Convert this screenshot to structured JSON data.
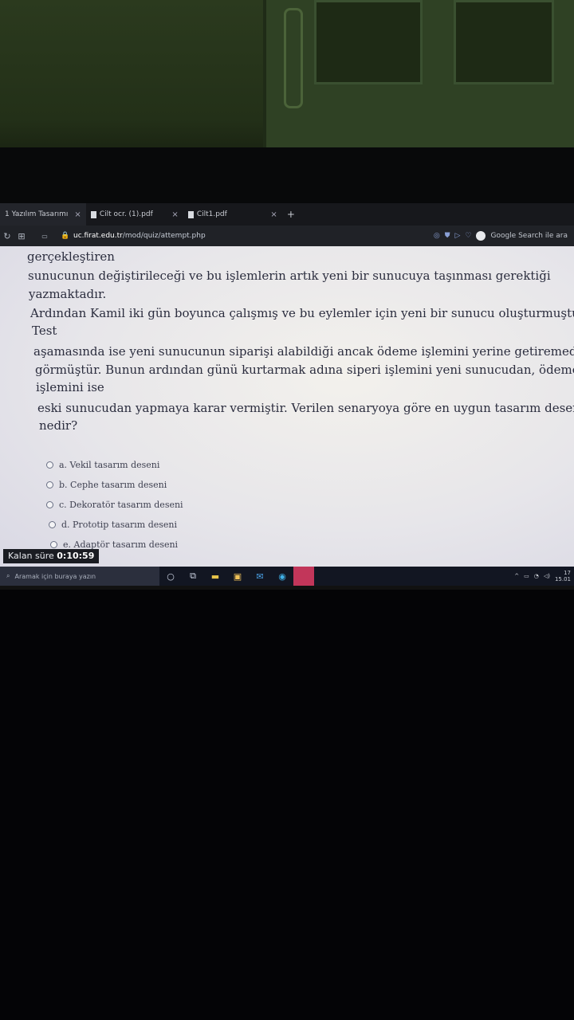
{
  "browser": {
    "tabs": [
      {
        "label": "1 Yazılım Tasarımı",
        "active": true
      },
      {
        "label": "Cilt ocr. (1).pdf",
        "active": false
      },
      {
        "label": "Cilt1.pdf",
        "active": false
      }
    ],
    "new_tab": "+",
    "close_glyph": "×",
    "url_host": "uc.firat.edu.tr",
    "url_path": "/mod/quiz/attempt.php",
    "search_hint": "Google Search ile ara"
  },
  "question": {
    "lines": [
      "gerçekleştiren",
      "sunucunun değiştirileceği ve bu işlemlerin artık yeni bir sunucuya taşınması gerektiği",
      "yazmaktadır.",
      "Ardından Kamil iki gün boyunca çalışmış ve bu eylemler için yeni bir sunucu oluşturmuştur.",
      "Test",
      "aşamasında ise yeni sunucunun siparişi alabildiği ancak ödeme işlemini yerine getiremediğini",
      "görmüştür. Bunun ardından günü kurtarmak adına siperi işlemini yeni sunucudan, ödeme",
      "işlemini ise",
      "eski sunucudan yapmaya karar vermiştir. Verilen senaryoya göre en uygun tasarım deseni",
      "nedir?"
    ]
  },
  "answers": [
    "a. Vekil tasarım deseni",
    "b. Cephe tasarım deseni",
    "c. Dekoratör tasarım deseni",
    "d. Prototip tasarım deseni",
    "e. Adaptör tasarım deseni"
  ],
  "timer": {
    "label": "Kalan süre",
    "value": "0:10:59"
  },
  "taskbar": {
    "search_placeholder": "Aramak için buraya yazın",
    "clock_time": "17",
    "clock_date": "15.01"
  },
  "colors": {
    "page_text": "#2b2d3e",
    "taskbar": "#121622",
    "accent_app": "#c2365a"
  }
}
